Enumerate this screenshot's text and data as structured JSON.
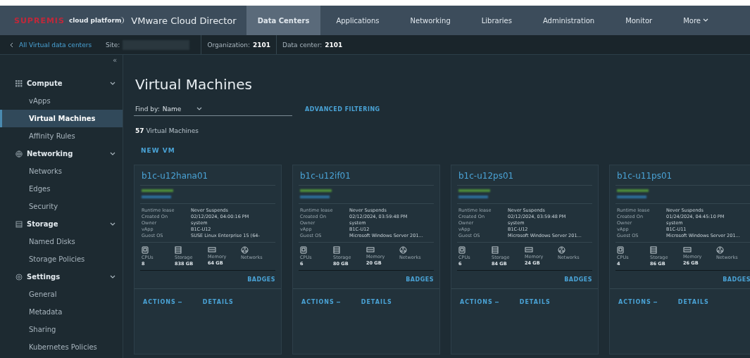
{
  "header": {
    "brand": "SUPREMIS",
    "platform": "cloud platform",
    "title": "VMware Cloud Director",
    "tabs": [
      {
        "label": "Data Centers",
        "selected": true
      },
      {
        "label": "Applications",
        "selected": false
      },
      {
        "label": "Networking",
        "selected": false
      },
      {
        "label": "Libraries",
        "selected": false
      },
      {
        "label": "Administration",
        "selected": false
      },
      {
        "label": "Monitor",
        "selected": false
      },
      {
        "label": "More",
        "selected": false
      }
    ]
  },
  "breadcrumb": {
    "back": "All Virtual data centers",
    "site_label": "Site:",
    "organization_label": "Organization:",
    "organization": "2101",
    "datacenter_label": "Data center:",
    "datacenter": "2101"
  },
  "sidebar": {
    "collapse": "«",
    "sections": [
      {
        "label": "Compute",
        "expanded": true,
        "children": [
          {
            "label": "vApps",
            "selected": false
          },
          {
            "label": "Virtual Machines",
            "selected": true
          },
          {
            "label": "Affinity Rules",
            "selected": false
          }
        ]
      },
      {
        "label": "Networking",
        "expanded": true,
        "children": [
          {
            "label": "Networks",
            "selected": false
          },
          {
            "label": "Edges",
            "selected": false
          },
          {
            "label": "Security",
            "selected": false
          }
        ]
      },
      {
        "label": "Storage",
        "expanded": true,
        "children": [
          {
            "label": "Named Disks",
            "selected": false
          },
          {
            "label": "Storage Policies",
            "selected": false
          }
        ]
      },
      {
        "label": "Settings",
        "expanded": true,
        "children": [
          {
            "label": "General",
            "selected": false
          },
          {
            "label": "Metadata",
            "selected": false
          },
          {
            "label": "Sharing",
            "selected": false
          },
          {
            "label": "Kubernetes Policies",
            "selected": false
          }
        ]
      }
    ]
  },
  "page": {
    "title": "Virtual Machines",
    "find_by": "Find by:",
    "find_value": "Name",
    "advanced": "ADVANCED FILTERING",
    "count": "57",
    "count_label": "Virtual Machines",
    "new_vm": "NEW VM"
  },
  "cards": [
    {
      "name": "b1c-u12hana01",
      "fields": [
        {
          "label": "Runtime lease",
          "value": "Never Suspends"
        },
        {
          "label": "Created On",
          "value": "02/12/2024, 04:00:16 PM"
        },
        {
          "label": "Owner",
          "value": "system"
        },
        {
          "label": "vApp",
          "value": "B1C-U12"
        },
        {
          "label": "Guest OS",
          "value": "SUSE Linux Enterprise 15 (64-"
        }
      ],
      "stats": [
        {
          "label": "CPUs",
          "value": "8"
        },
        {
          "label": "Storage",
          "value": "838 GB"
        },
        {
          "label": "Memory",
          "value": "64 GB"
        },
        {
          "label": "Networks"
        }
      ],
      "badges": "BADGES",
      "actions": "ACTIONS",
      "details": "DETAILS"
    },
    {
      "name": "b1c-u12if01",
      "fields": [
        {
          "label": "Runtime lease",
          "value": "Never Suspends"
        },
        {
          "label": "Created On",
          "value": "02/12/2024, 03:59:48 PM"
        },
        {
          "label": "Owner",
          "value": "system"
        },
        {
          "label": "vApp",
          "value": "B1C-U12"
        },
        {
          "label": "Guest OS",
          "value": "Microsoft Windows Server 201..."
        }
      ],
      "stats": [
        {
          "label": "CPUs",
          "value": "6"
        },
        {
          "label": "Storage",
          "value": "80 GB"
        },
        {
          "label": "Memory",
          "value": "20 GB"
        },
        {
          "label": "Networks"
        }
      ],
      "badges": "BADGES",
      "actions": "ACTIONS",
      "details": "DETAILS"
    },
    {
      "name": "b1c-u12ps01",
      "fields": [
        {
          "label": "Runtime lease",
          "value": "Never Suspends"
        },
        {
          "label": "Created On",
          "value": "02/12/2024, 03:59:48 PM"
        },
        {
          "label": "Owner",
          "value": "system"
        },
        {
          "label": "vApp",
          "value": "B1C-U12"
        },
        {
          "label": "Guest OS",
          "value": "Microsoft Windows Server 201..."
        }
      ],
      "stats": [
        {
          "label": "CPUs",
          "value": "6"
        },
        {
          "label": "Storage",
          "value": "84 GB"
        },
        {
          "label": "Memory",
          "value": "24 GB"
        },
        {
          "label": "Networks"
        }
      ],
      "badges": "BADGES",
      "actions": "ACTIONS",
      "details": "DETAILS"
    },
    {
      "name": "b1c-u11ps01",
      "fields": [
        {
          "label": "Runtime lease",
          "value": "Never Suspends"
        },
        {
          "label": "Created On",
          "value": "01/24/2024, 04:45:10 PM"
        },
        {
          "label": "Owner",
          "value": "system"
        },
        {
          "label": "vApp",
          "value": "B1C-U11"
        },
        {
          "label": "Guest OS",
          "value": "Microsoft Windows Server 201..."
        }
      ],
      "stats": [
        {
          "label": "CPUs",
          "value": "4"
        },
        {
          "label": "Storage",
          "value": "86 GB"
        },
        {
          "label": "Memory",
          "value": "26 GB"
        },
        {
          "label": "Networks"
        }
      ],
      "badges": "BADGES",
      "actions": "ACTIONS",
      "details": "DETAILS"
    }
  ]
}
